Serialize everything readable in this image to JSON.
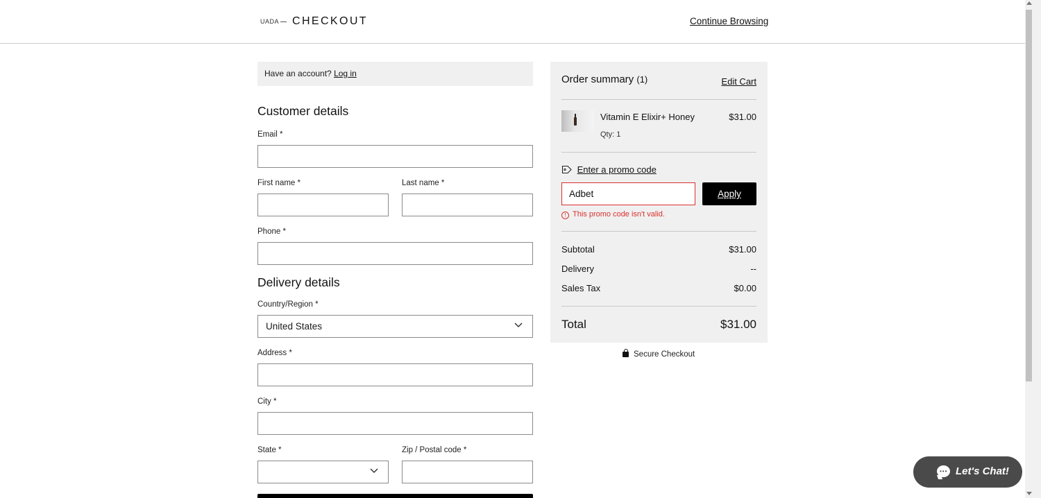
{
  "header": {
    "logo_text": "UADA",
    "title": "CHECKOUT",
    "continue_label": "Continue Browsing"
  },
  "login": {
    "prompt": "Have an account?",
    "link": "Log in"
  },
  "customer": {
    "title": "Customer details",
    "email_label": "Email *",
    "email_value": "",
    "first_name_label": "First name *",
    "first_name_value": "",
    "last_name_label": "Last name *",
    "last_name_value": "",
    "phone_label": "Phone *",
    "phone_value": ""
  },
  "delivery": {
    "title": "Delivery details",
    "country_label": "Country/Region *",
    "country_value": "United States",
    "address_label": "Address *",
    "address_value": "",
    "city_label": "City *",
    "city_value": "",
    "state_label": "State *",
    "state_value": "",
    "zip_label": "Zip / Postal code *",
    "zip_value": ""
  },
  "summary": {
    "title": "Order summary",
    "count": "(1)",
    "edit_cart": "Edit Cart",
    "item": {
      "name": "Vitamin E Elixir+ Honey",
      "price": "$31.00",
      "qty": "Qty: 1"
    },
    "promo_link": "Enter a promo code",
    "promo_value": "Adbet",
    "apply_label": "Apply",
    "promo_error": "This promo code isn't valid.",
    "subtotal_label": "Subtotal",
    "subtotal_value": "$31.00",
    "delivery_label": "Delivery",
    "delivery_value": "--",
    "tax_label": "Sales Tax",
    "tax_value": "$0.00",
    "total_label": "Total",
    "total_value": "$31.00"
  },
  "secure_label": "Secure Checkout",
  "chat_label": "Let's Chat!",
  "colors": {
    "error": "#d9302c",
    "panel": "#f0f0f0",
    "button": "#000000",
    "chat": "#4a4a4a"
  }
}
